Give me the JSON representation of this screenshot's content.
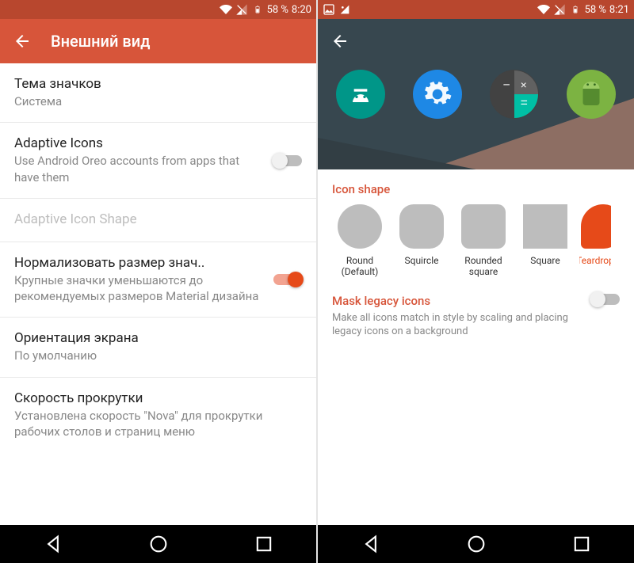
{
  "left": {
    "status": {
      "battery": "58 %",
      "time": "8:20"
    },
    "title": "Внешний вид",
    "items": [
      {
        "title": "Тема значков",
        "sub": "Система",
        "toggle": null,
        "disabled": false
      },
      {
        "title": "Adaptive Icons",
        "sub": "Use Android Oreo accounts from apps that have them",
        "toggle": "off",
        "disabled": false
      },
      {
        "title": "Adaptive Icon Shape",
        "sub": "",
        "toggle": null,
        "disabled": true
      },
      {
        "title": "Нормализовать размер знач..",
        "sub": "Крупные значки уменьшаются до рекомендуемых размеров Material дизайна",
        "toggle": "on",
        "disabled": false
      },
      {
        "title": "Ориентация экрана",
        "sub": "По умолчанию",
        "toggle": null,
        "disabled": false
      },
      {
        "title": "Скорость прокрутки",
        "sub": "Установлена скорость \"Nova\" для прокрутки рабочих столов и страниц меню",
        "toggle": null,
        "disabled": false
      }
    ]
  },
  "right": {
    "status": {
      "battery": "58 %",
      "time": "8:21"
    },
    "section_title": "Icon shape",
    "shapes": [
      {
        "label": "Round (Default)",
        "cls": "round",
        "selected": false
      },
      {
        "label": "Squircle",
        "cls": "squircle",
        "selected": false
      },
      {
        "label": "Rounded square",
        "cls": "rsq",
        "selected": false
      },
      {
        "label": "Square",
        "cls": "sq",
        "selected": false
      },
      {
        "label": "Teardrop",
        "cls": "tear",
        "selected": true
      }
    ],
    "mask": {
      "title": "Mask legacy icons",
      "sub": "Make all icons match in style by scaling and placing legacy icons on a background",
      "toggle": "off"
    },
    "preview_icons": [
      "android-studio-icon",
      "settings-icon",
      "calculator-icon",
      "android-icon"
    ]
  },
  "accent": "#D7553A"
}
